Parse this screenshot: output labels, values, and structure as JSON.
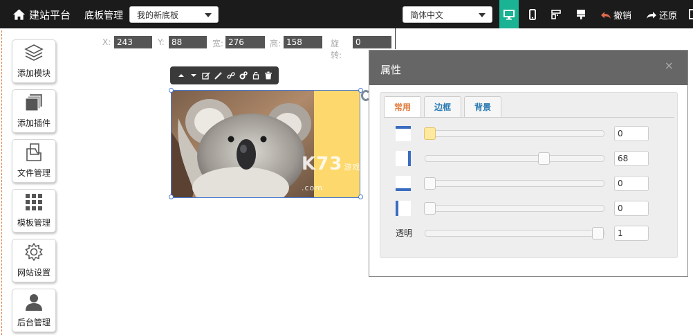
{
  "topbar": {
    "title": "建站平台",
    "section": "底板管理",
    "template_select": "我的新底板",
    "language_select": "简体中文",
    "undo_label": "撤销",
    "redo_label": "还原",
    "accent_color": "#1ab394"
  },
  "sidebar": {
    "items": [
      {
        "label": "添加模块",
        "icon": "layers-icon"
      },
      {
        "label": "添加插件",
        "icon": "stack-icon"
      },
      {
        "label": "文件管理",
        "icon": "file-icon"
      },
      {
        "label": "模板管理",
        "icon": "grid-icon"
      },
      {
        "label": "网站设置",
        "icon": "gear-icon"
      },
      {
        "label": "后台管理",
        "icon": "user-icon"
      }
    ]
  },
  "coords": {
    "x_label": "X:",
    "x_value": "243",
    "y_label": "Y:",
    "y_value": "88",
    "w_label": "宽:",
    "w_value": "276",
    "h_label": "高:",
    "h_value": "158",
    "r_label": "旋转:",
    "r_value": "0"
  },
  "watermark": {
    "main": "K73",
    "sub": "游戏之家",
    "suffix": ".com"
  },
  "panel": {
    "title": "属性",
    "close": "×",
    "tabs": [
      "常用",
      "边框",
      "背景"
    ],
    "rows": [
      {
        "side": "top",
        "value": "0",
        "percent": 0
      },
      {
        "side": "right",
        "value": "68",
        "percent": 68
      },
      {
        "side": "bottom",
        "value": "0",
        "percent": 0
      },
      {
        "side": "left",
        "value": "0",
        "percent": 0
      }
    ],
    "opacity_label": "透明",
    "opacity_value": "1",
    "opacity_percent": 100
  }
}
